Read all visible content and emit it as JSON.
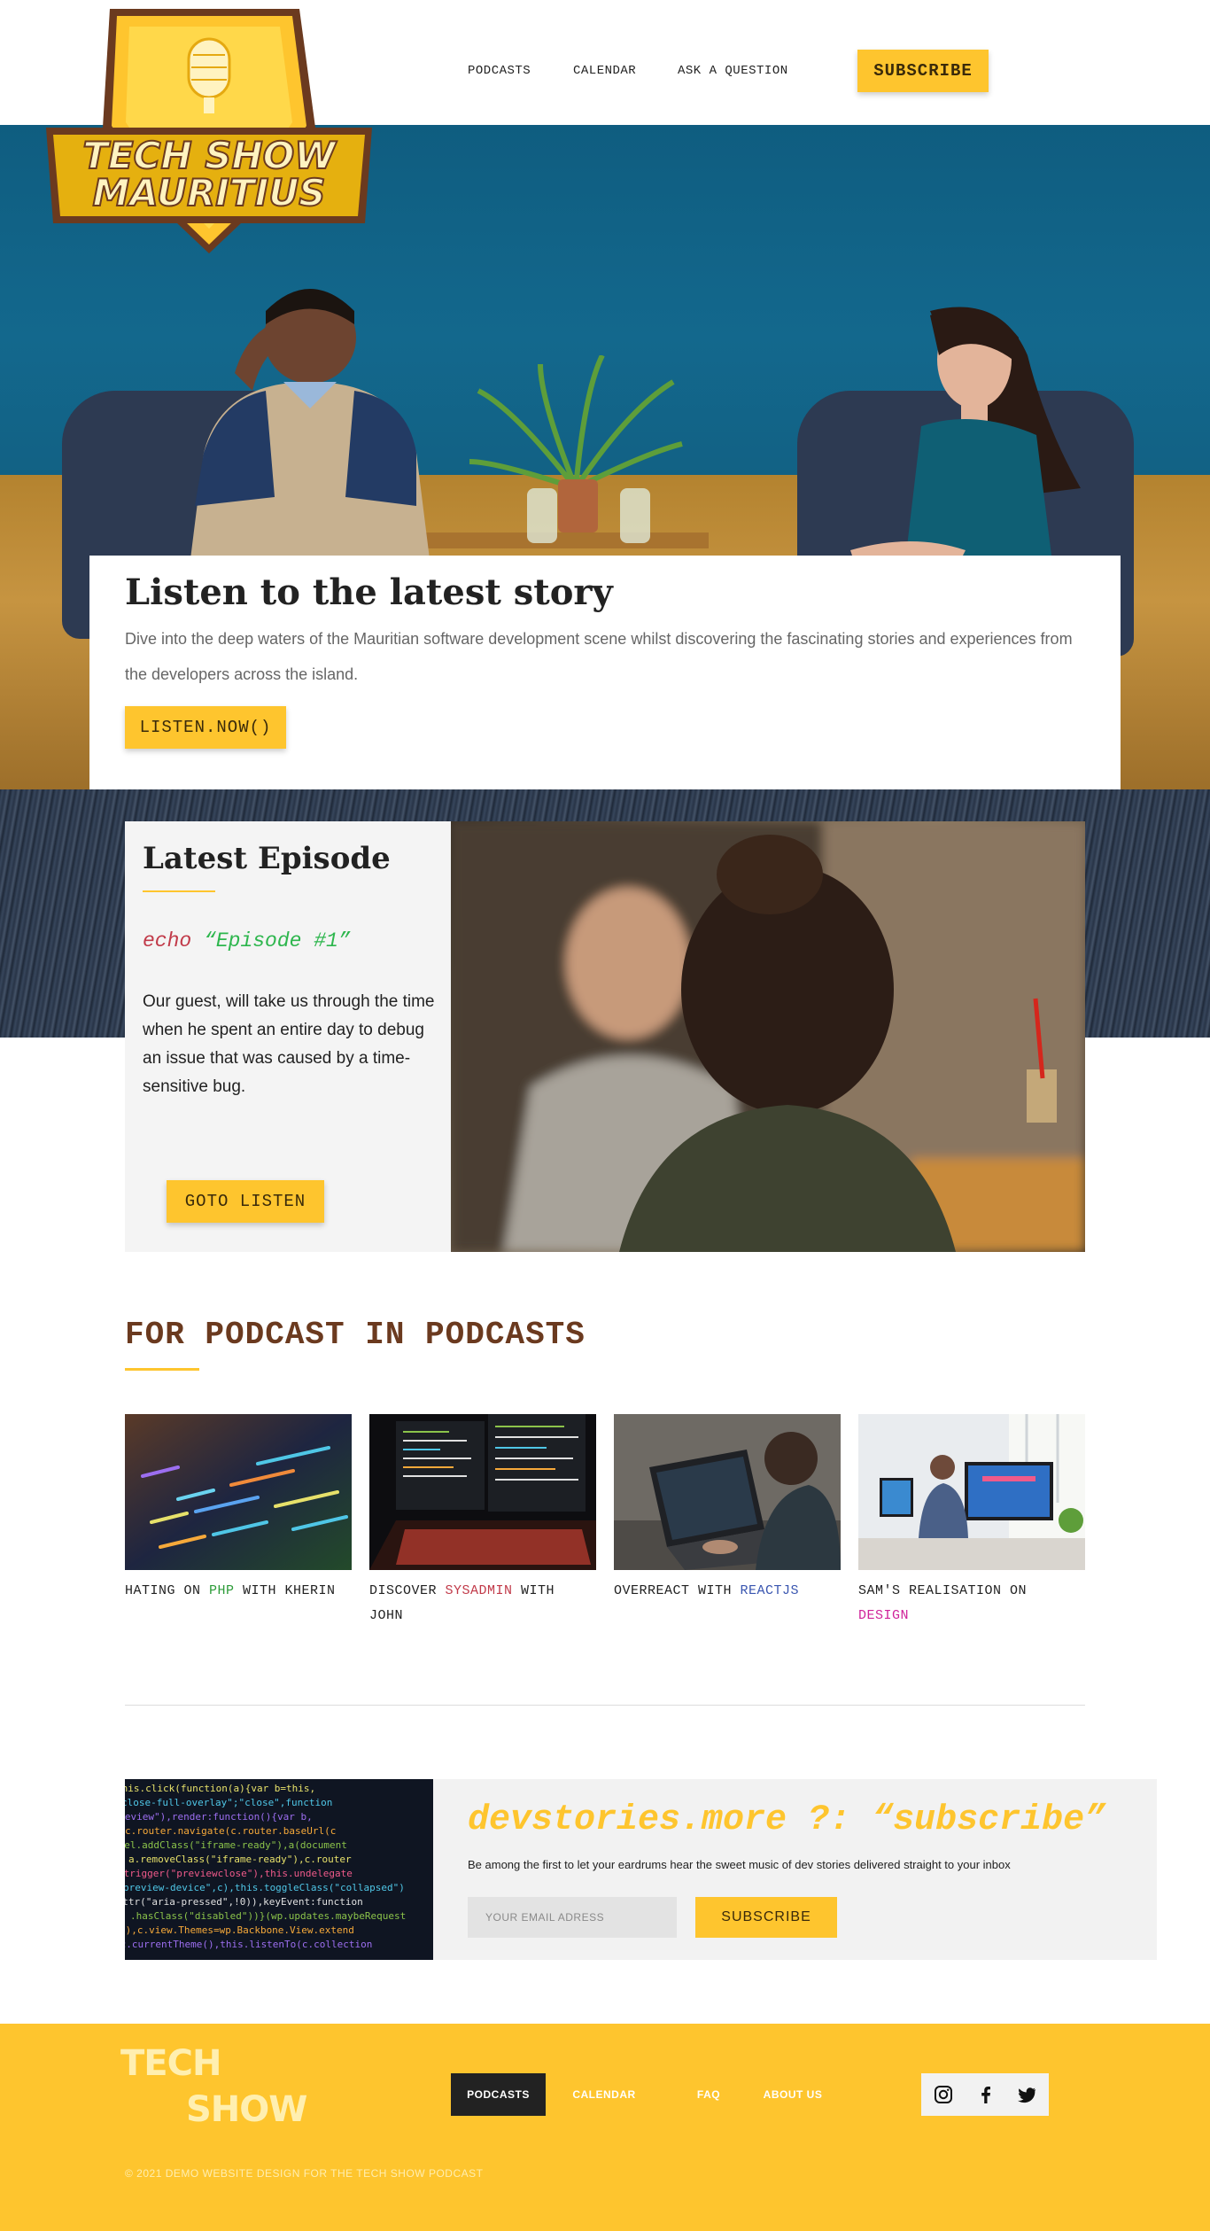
{
  "logo": {
    "line1": "TECH SHOW",
    "line2": "MAURITIUS"
  },
  "nav": {
    "podcasts": "PODCASTS",
    "calendar": "CALENDAR",
    "ask": "ASK A QUESTION",
    "subscribe": "SUBSCRIBE"
  },
  "hero": {
    "title": "Listen to the latest story",
    "text": "Dive into the deep waters of the Mauritian software development scene whilst discovering the fascinating stories and experiences from the developers across the island.",
    "button": "LISTEN.NOW()"
  },
  "episode": {
    "title": "Latest Episode",
    "code_keyword": "echo",
    "code_string": "“Episode #1”",
    "text": "Our guest, will take us through the time when he spent an entire day to debug an issue that was caused by a time-sensitive bug.",
    "button": "GOTO LISTEN"
  },
  "podcasts": {
    "title": "FOR PODCAST IN PODCASTS",
    "items": [
      {
        "pre": "HATING ON ",
        "tag": "PHP",
        "post": " WITH KHERIN",
        "tag_color": "#2e9c3a"
      },
      {
        "pre": "DISCOVER ",
        "tag": "SYSADMIN",
        "post": " WITH JOHN",
        "tag_color": "#c13a49"
      },
      {
        "pre": "OVERREACT WITH ",
        "tag": "REACTJS",
        "post": "",
        "tag_color": "#3a56b0"
      },
      {
        "pre": "SAM'S REALISATION ON ",
        "tag": "DESIGN",
        "post": "",
        "tag_color": "#d0239a"
      }
    ]
  },
  "newsletter": {
    "title": "devstories.more ?: “subscribe”",
    "text": "Be among the first to let your eardrums hear the sweet music of dev stories delivered straight to your inbox",
    "placeholder": "YOUR EMAIL ADRESS",
    "button": "SUBSCRIBE"
  },
  "footer": {
    "logo_line1": "TECH",
    "logo_line2": "SHOW",
    "nav": [
      "PODCASTS",
      "CALENDAR",
      "FAQ",
      "ABOUT US"
    ],
    "copyright": "© 2021 DEMO WEBSITE DESIGN FOR THE TECH SHOW PODCAST",
    "social": [
      "instagram-icon",
      "facebook-icon",
      "twitter-icon"
    ]
  },
  "colors": {
    "accent": "#fec52e",
    "brown": "#6b3a1f",
    "dark": "#222222"
  }
}
